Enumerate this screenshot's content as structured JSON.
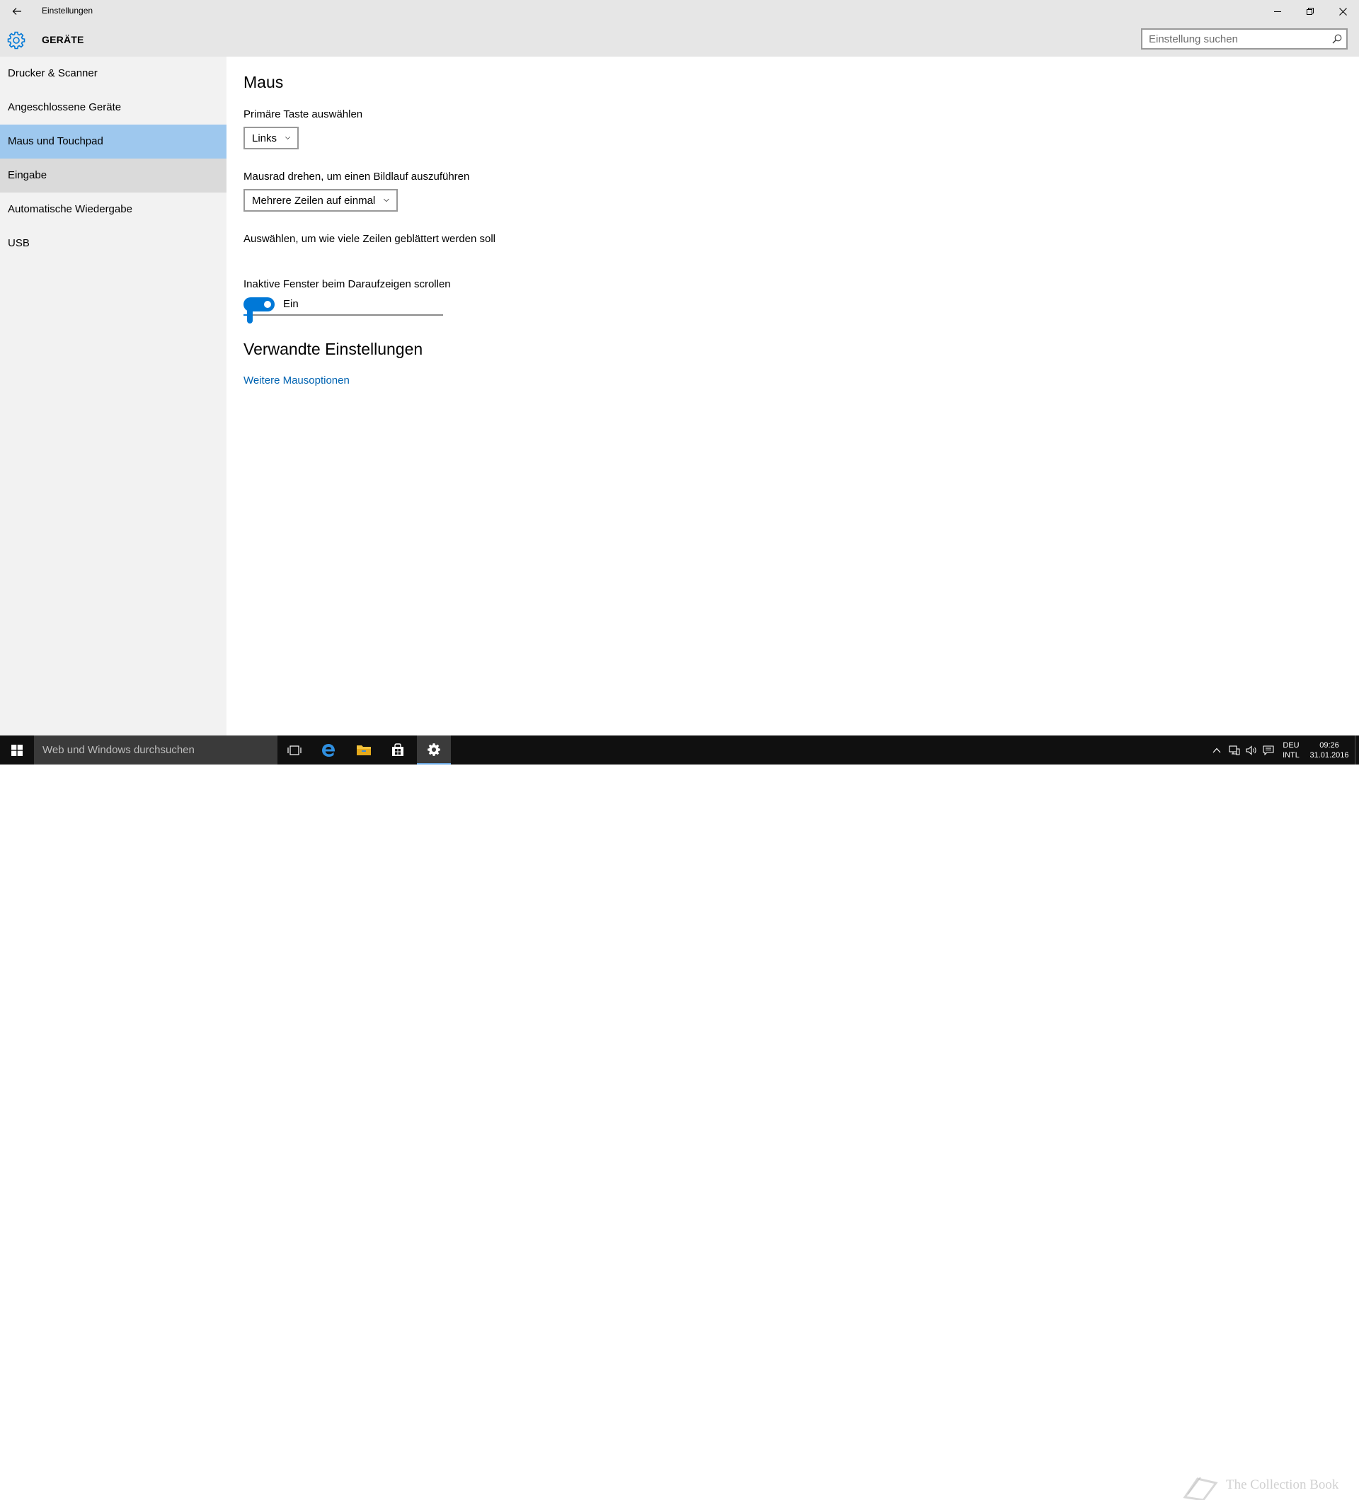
{
  "window": {
    "title": "Einstellungen"
  },
  "header": {
    "category": "GERÄTE",
    "search_placeholder": "Einstellung suchen"
  },
  "sidebar": {
    "items": [
      {
        "label": "Drucker & Scanner",
        "state": "normal"
      },
      {
        "label": "Angeschlossene Geräte",
        "state": "normal"
      },
      {
        "label": "Maus und Touchpad",
        "state": "selected"
      },
      {
        "label": "Eingabe",
        "state": "hover"
      },
      {
        "label": "Automatische Wiedergabe",
        "state": "normal"
      },
      {
        "label": "USB",
        "state": "normal"
      }
    ]
  },
  "main": {
    "title": "Maus",
    "primary_button": {
      "label": "Primäre Taste auswählen",
      "value": "Links"
    },
    "scroll_wheel": {
      "label": "Mausrad drehen, um einen Bildlauf auszuführen",
      "value": "Mehrere Zeilen auf einmal"
    },
    "lines_slider": {
      "label": "Auswählen, um wie viele Zeilen geblättert werden soll",
      "level": 0.02
    },
    "inactive_scroll": {
      "label": "Inaktive Fenster beim Daraufzeigen scrollen",
      "state": "Ein",
      "on": true
    },
    "related": {
      "title": "Verwandte Einstellungen",
      "link": "Weitere Mausoptionen"
    }
  },
  "taskbar": {
    "search_placeholder": "Web und Windows durchsuchen",
    "language_top": "DEU",
    "language_bottom": "INTL",
    "time": "09:26",
    "date": "31.01.2016",
    "watermark": "The Collection Book"
  },
  "colors": {
    "accent": "#0078d7",
    "link": "#0063b1",
    "selected_nav": "#9ec8ee",
    "chrome": "#e6e6e6",
    "sidebar": "#f2f2f2",
    "taskbar": "#101010"
  }
}
